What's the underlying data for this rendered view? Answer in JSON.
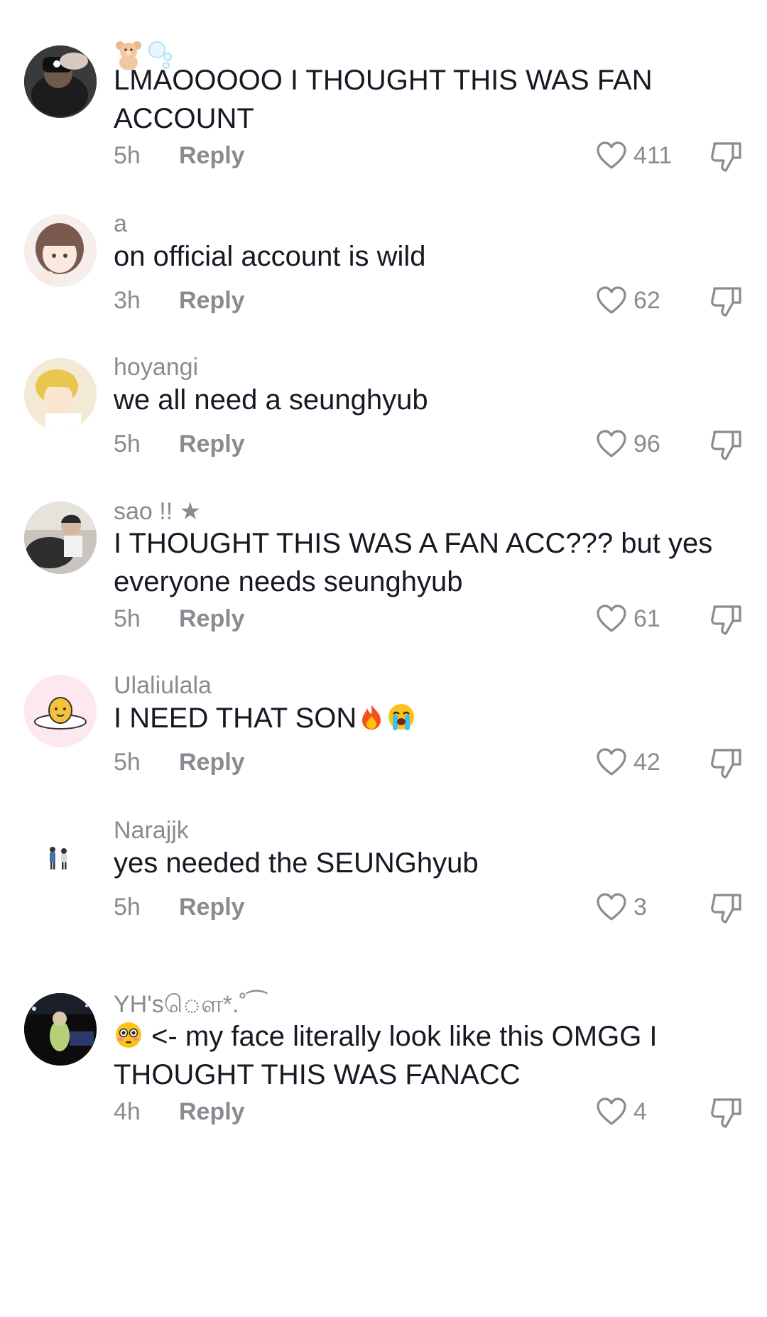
{
  "comments": [
    {
      "username": "",
      "username_icons": [
        "teddy-bear-icon",
        "bubbles-icon"
      ],
      "text": "LMAOOOOO I THOUGHT THIS WAS FAN ACCOUNT",
      "time": "5h",
      "reply_label": "Reply",
      "likes": "411"
    },
    {
      "username": "a",
      "text": "on official account is wild",
      "time": "3h",
      "reply_label": "Reply",
      "likes": "62"
    },
    {
      "username": "hoyangi",
      "text": "we all need a seunghyub",
      "time": "5h",
      "reply_label": "Reply",
      "likes": "96"
    },
    {
      "username": "sao !! ★",
      "text": "I THOUGHT THIS WAS A FAN ACC??? but yes everyone needs seunghyub",
      "time": "5h",
      "reply_label": "Reply",
      "likes": "61"
    },
    {
      "username": "Ulaliulala",
      "text": "I NEED THAT SON",
      "text_emojis": [
        "fire-emoji",
        "loudly-crying-emoji"
      ],
      "time": "5h",
      "reply_label": "Reply",
      "likes": "42"
    },
    {
      "username": "Narajjk",
      "text": "yes needed the SEUNGhyub",
      "time": "5h",
      "reply_label": "Reply",
      "likes": "3"
    },
    {
      "username": "YH'sௌ*.˚⁀",
      "text_prefix_emoji": "flushed-face-emoji",
      "text": "<- my face literally look like this OMGG I THOUGHT THIS WAS FANACC",
      "time": "4h",
      "reply_label": "Reply",
      "likes": "4"
    }
  ],
  "colors": {
    "text": "#161823",
    "secondary": "#8a8b91",
    "background": "#ffffff"
  }
}
